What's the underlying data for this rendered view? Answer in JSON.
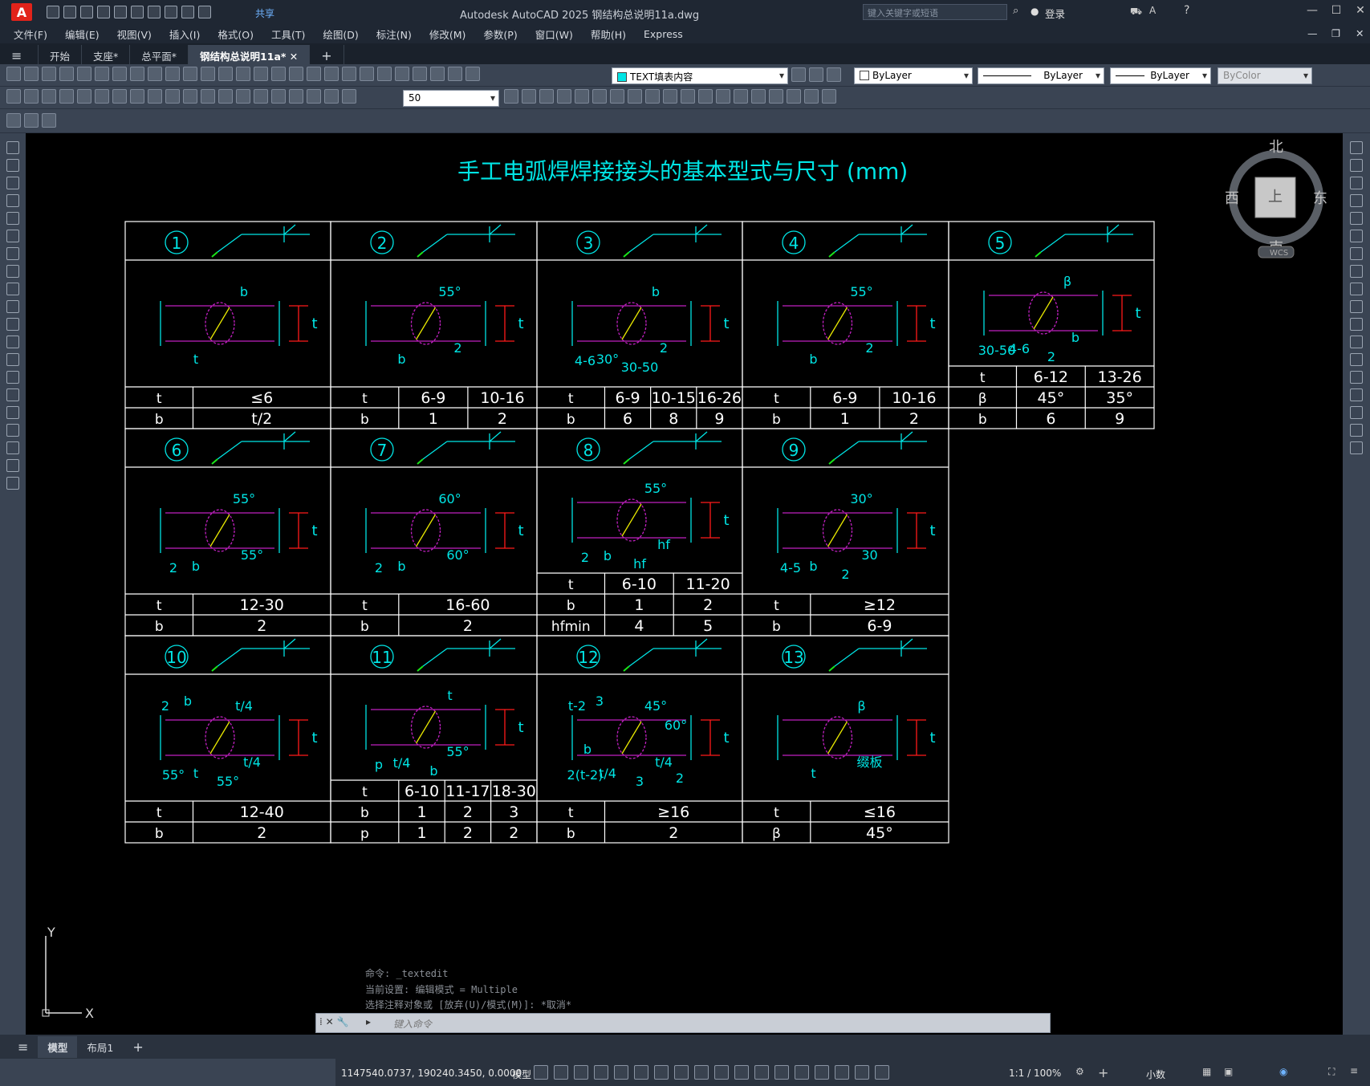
{
  "app": {
    "title": "Autodesk AutoCAD 2025    钢结构总说明11a.dwg",
    "share_label": "共享",
    "search_placeholder": "键入关键字或短语",
    "login_label": "登录"
  },
  "menu": [
    "文件(F)",
    "编辑(E)",
    "视图(V)",
    "插入(I)",
    "格式(O)",
    "工具(T)",
    "绘图(D)",
    "标注(N)",
    "修改(M)",
    "参数(P)",
    "窗口(W)",
    "帮助(H)",
    "Express"
  ],
  "doc_tabs": [
    "开始",
    "支座*",
    "总平面*",
    "钢结构总说明11a*"
  ],
  "toolbar": {
    "text_style": "TEXT填表内容",
    "dim_scale": "50",
    "layer": "ByLayer",
    "linetype": "ByLayer",
    "lineweight": "ByLayer",
    "plotstyle": "ByColor"
  },
  "viewcube": {
    "north": "北",
    "south": "南",
    "east": "东",
    "west": "西",
    "top": "上",
    "wcs": "WCS"
  },
  "ucs": {
    "x": "X",
    "y": "Y"
  },
  "drawing": {
    "title": "手工电弧焊焊接接头的基本型式与尺寸 (mm)",
    "cells": [
      {
        "num": "1",
        "rows": [
          [
            "t",
            "≤6"
          ],
          [
            "b",
            "t/2"
          ]
        ],
        "dims": [
          "b",
          "t"
        ]
      },
      {
        "num": "2",
        "rows": [
          [
            "t",
            "6-9",
            "10-16"
          ],
          [
            "b",
            "1",
            "2"
          ]
        ],
        "dims": [
          "55°",
          "b",
          "2"
        ]
      },
      {
        "num": "3",
        "rows": [
          [
            "t",
            "6-9",
            "10-15",
            "16-26"
          ],
          [
            "b",
            "6",
            "8",
            "9"
          ]
        ],
        "dims": [
          "b",
          "30°",
          "2",
          "4-6",
          "30-50"
        ]
      },
      {
        "num": "4",
        "rows": [
          [
            "t",
            "6-9",
            "10-16"
          ],
          [
            "b",
            "1",
            "2"
          ]
        ],
        "dims": [
          "55°",
          "b",
          "2"
        ]
      },
      {
        "num": "5",
        "rows": [
          [
            "t",
            "6-12",
            "13-26"
          ],
          [
            "β",
            "45°",
            "35°"
          ],
          [
            "b",
            "6",
            "9"
          ]
        ],
        "dims": [
          "β",
          "4-6",
          "b",
          "30-50",
          "2"
        ]
      },
      {
        "num": "6",
        "rows": [
          [
            "t",
            "12-30"
          ],
          [
            "b",
            "2"
          ]
        ],
        "dims": [
          "55°",
          "b",
          "55°",
          "2"
        ]
      },
      {
        "num": "7",
        "rows": [
          [
            "t",
            "16-60"
          ],
          [
            "b",
            "2"
          ]
        ],
        "dims": [
          "60°",
          "b",
          "60°",
          "2"
        ]
      },
      {
        "num": "8",
        "rows": [
          [
            "t",
            "6-10",
            "11-20"
          ],
          [
            "b",
            "1",
            "2"
          ],
          [
            "hfmin",
            "4",
            "5"
          ]
        ],
        "dims": [
          "55°",
          "b",
          "hf",
          "2",
          "hf"
        ]
      },
      {
        "num": "9",
        "rows": [
          [
            "t",
            "≥12"
          ],
          [
            "b",
            "6-9"
          ]
        ],
        "dims": [
          "30°",
          "b",
          "30",
          "4-5",
          "2"
        ]
      },
      {
        "num": "10",
        "rows": [
          [
            "t",
            "12-40"
          ],
          [
            "b",
            "2"
          ]
        ],
        "dims": [
          "t/4",
          "t",
          "t/4",
          "55°",
          "55°",
          "2",
          "b"
        ]
      },
      {
        "num": "11",
        "rows": [
          [
            "t",
            "6-10",
            "11-17",
            "18-30"
          ],
          [
            "b",
            "1",
            "2",
            "3"
          ],
          [
            "p",
            "1",
            "2",
            "2"
          ]
        ],
        "dims": [
          "t",
          "t/4",
          "55°",
          "p",
          "b"
        ]
      },
      {
        "num": "12",
        "rows": [
          [
            "t",
            "≥16"
          ],
          [
            "b",
            "2"
          ]
        ],
        "dims": [
          "45°",
          "t/4",
          "t/4",
          "2(t-2)",
          "3",
          "t-2",
          "3",
          "60°",
          "b",
          "2"
        ]
      },
      {
        "num": "13",
        "rows": [
          [
            "t",
            "≤16"
          ],
          [
            "β",
            "45°"
          ]
        ],
        "dims": [
          "β",
          "t",
          "缀板"
        ]
      }
    ]
  },
  "command": {
    "history": [
      "命令: _textedit",
      "当前设置: 编辑模式 = Multiple",
      "选择注释对象或 [放弃(U)/模式(M)]: *取消*"
    ],
    "placeholder": "键入命令"
  },
  "layouts": [
    "模型",
    "布局1"
  ],
  "status": {
    "coords": "1147540.0737, 190240.3450, 0.0000",
    "mode": "模型",
    "scale": "1:1 / 100%",
    "units": "小数"
  },
  "colors": {
    "canvas": "#000000",
    "cyan": "#00e5e5",
    "red": "#ff1a1a",
    "magenta": "#c020c0",
    "yellow": "#e8e800",
    "green": "#19e619",
    "white": "#ffffff"
  }
}
